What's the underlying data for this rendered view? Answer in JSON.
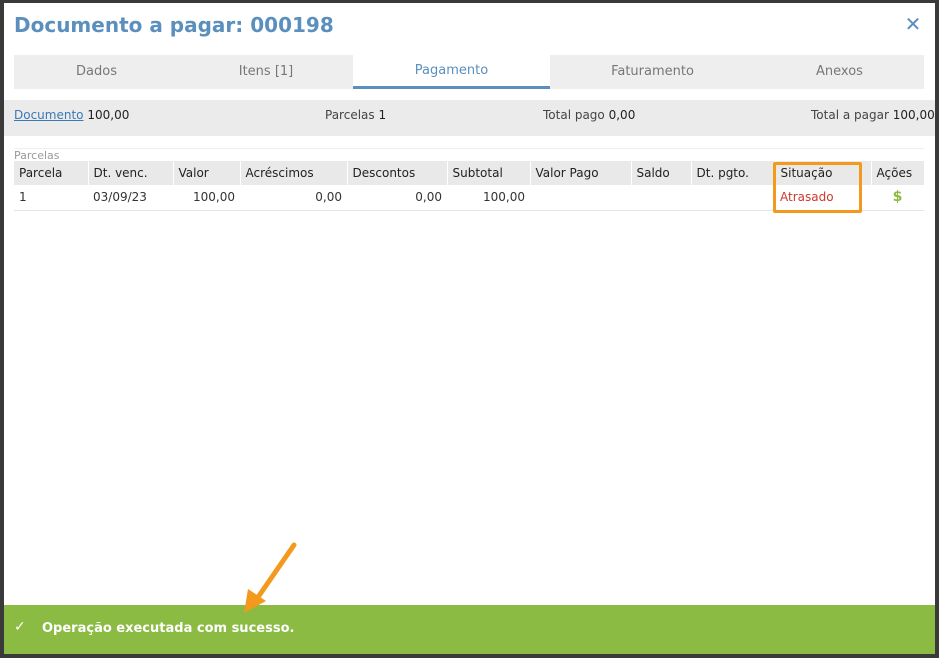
{
  "modal": {
    "title": "Documento a pagar: 000198",
    "close_label": "✕"
  },
  "tabs": [
    {
      "label": "Dados",
      "active": false
    },
    {
      "label": "Itens [1]",
      "active": false
    },
    {
      "label": "Pagamento",
      "active": true
    },
    {
      "label": "Faturamento",
      "active": false
    },
    {
      "label": "Anexos",
      "active": false
    }
  ],
  "summary": {
    "documento_label": "Documento",
    "documento_value": "100,00",
    "parcelas_label": "Parcelas",
    "parcelas_value": "1",
    "total_pago_label": "Total pago",
    "total_pago_value": "0,00",
    "total_pagar_label": "Total a pagar",
    "total_pagar_value": "100,00"
  },
  "section": {
    "title": "Parcelas"
  },
  "table": {
    "headers": [
      "Parcela",
      "Dt. venc.",
      "Valor",
      "Acréscimos",
      "Descontos",
      "Subtotal",
      "Valor Pago",
      "Saldo",
      "Dt. pgto.",
      "Situação",
      "Ações"
    ],
    "rows": [
      {
        "parcela": "1",
        "dt_venc": "03/09/23",
        "valor": "100,00",
        "acrescimos": "0,00",
        "descontos": "0,00",
        "subtotal": "100,00",
        "valor_pago": "",
        "saldo": "",
        "dt_pgto": "",
        "situacao": "Atrasado",
        "acoes_icon": "$"
      }
    ]
  },
  "toast": {
    "icon": "✓",
    "message": "Operação executada com sucesso."
  },
  "colors": {
    "accent": "#5b8fbd",
    "late": "#d0382b",
    "success": "#8bbb43",
    "highlight": "#f39a1e"
  }
}
